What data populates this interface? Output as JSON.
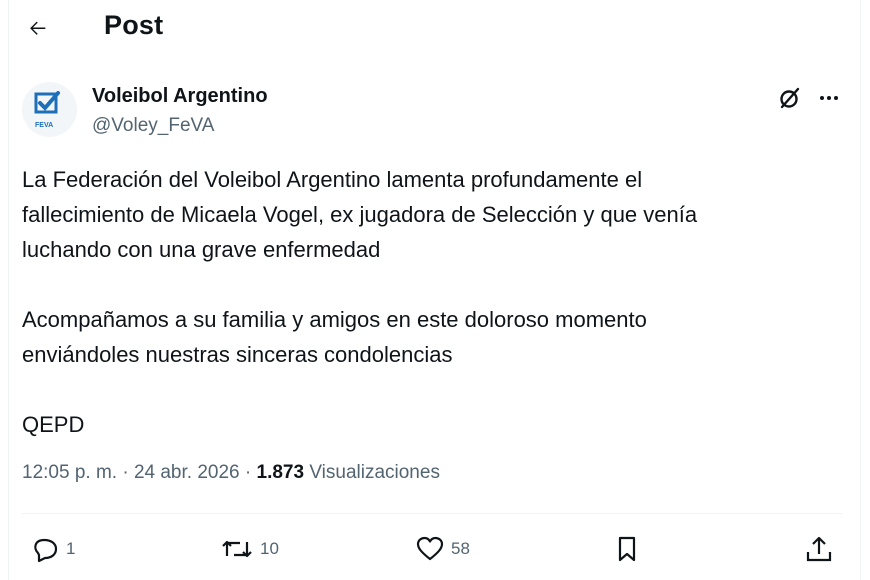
{
  "header": {
    "title": "Post",
    "back_icon": "arrow-left-icon"
  },
  "author": {
    "name": "Voleibol Argentino",
    "handle": "@Voley_FeVA",
    "avatar_text": "FEVA",
    "avatar_icon": "feva-logo"
  },
  "post": {
    "paragraphs": [
      "La Federación del Voleibol Argentino lamenta profundamente el\nfallecimiento de Micaela Vogel, ex jugadora de Selección y que venía\nluchando con una grave enfermedad",
      "Acompañamos a su familia y amigos en este doloroso momento\nenviándoles nuestras sinceras condolencias",
      "QEPD"
    ],
    "time": "12:05 p. m.",
    "date": "24 abr. 2026",
    "views_count": "1.873",
    "views_label": "Visualizaciones",
    "separator": "·"
  },
  "actions": {
    "replies": "1",
    "reposts": "10",
    "likes": "58"
  },
  "colors": {
    "text": "#0f1419",
    "secondary": "#536471",
    "brand": "#1d6fb8"
  }
}
